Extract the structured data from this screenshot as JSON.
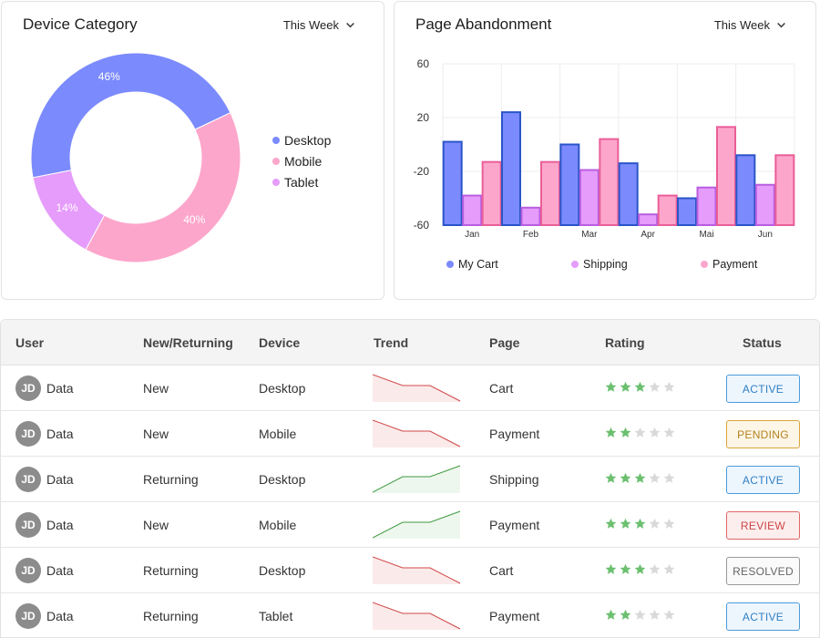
{
  "device_card": {
    "title": "Device Category",
    "period": "This Week",
    "chart_data": {
      "type": "pie",
      "categories": [
        "Desktop",
        "Mobile",
        "Tablet"
      ],
      "values": [
        46,
        40,
        14
      ],
      "labels": [
        "46%",
        "40%",
        "14%"
      ],
      "colors": [
        "#7b8afd",
        "#fda6cb",
        "#e59cfb"
      ],
      "legend": "right"
    }
  },
  "abandon_card": {
    "title": "Page Abandonment",
    "period": "This Week",
    "chart_data": {
      "type": "bar",
      "categories": [
        "Jan",
        "Feb",
        "Mar",
        "Apr",
        "Mai",
        "Jun"
      ],
      "series": [
        {
          "name": "My Cart",
          "values": [
            2,
            24,
            0,
            -14,
            -40,
            -8
          ],
          "color": "#7b8afd"
        },
        {
          "name": "Shipping",
          "values": [
            -38,
            -47,
            -19,
            -52,
            -32,
            -30
          ],
          "color": "#e59cfb"
        },
        {
          "name": "Payment",
          "values": [
            -13,
            -13,
            4,
            -38,
            13,
            -8
          ],
          "color": "#fda6cb"
        }
      ],
      "yticks": [
        "60",
        "20",
        "-20",
        "-60"
      ],
      "ylim": [
        -60,
        60
      ],
      "grid": true,
      "legend": "bottom"
    }
  },
  "table": {
    "headers": {
      "user": "User",
      "type": "New/Returning",
      "device": "Device",
      "trend": "Trend",
      "page": "Page",
      "rating": "Rating",
      "status": "Status"
    },
    "rows": [
      {
        "initials": "JD",
        "name": "Data",
        "type": "New",
        "device": "Desktop",
        "trend": "down",
        "page": "Cart",
        "rating": 3,
        "status": "ACTIVE",
        "status_kind": "active"
      },
      {
        "initials": "JD",
        "name": "Data",
        "type": "New",
        "device": "Mobile",
        "trend": "down",
        "page": "Payment",
        "rating": 2,
        "status": "PENDING",
        "status_kind": "pending"
      },
      {
        "initials": "JD",
        "name": "Data",
        "type": "Returning",
        "device": "Desktop",
        "trend": "up",
        "page": "Shipping",
        "rating": 3,
        "status": "ACTIVE",
        "status_kind": "active"
      },
      {
        "initials": "JD",
        "name": "Data",
        "type": "New",
        "device": "Mobile",
        "trend": "up",
        "page": "Payment",
        "rating": 3,
        "status": "REVIEW",
        "status_kind": "review"
      },
      {
        "initials": "JD",
        "name": "Data",
        "type": "Returning",
        "device": "Desktop",
        "trend": "down",
        "page": "Cart",
        "rating": 3,
        "status": "RESOLVED",
        "status_kind": "resolved"
      },
      {
        "initials": "JD",
        "name": "Data",
        "type": "Returning",
        "device": "Tablet",
        "trend": "down",
        "page": "Payment",
        "rating": 2,
        "status": "ACTIVE",
        "status_kind": "active"
      }
    ]
  },
  "icons": {
    "period_dropdown": "chevron-down-icon",
    "rating": "star-icon",
    "avatar": "user-avatar"
  },
  "colors": {
    "star_on": "#6cc070",
    "star_off": "#d9d9d9",
    "trend_down": "#d04848",
    "trend_up": "#3f9a3f"
  }
}
